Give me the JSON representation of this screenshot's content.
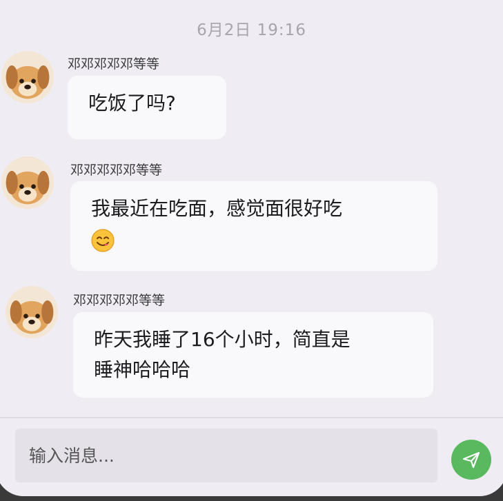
{
  "chat": {
    "timestamp": "6月2日 19:16",
    "messages": [
      {
        "sender": "邓邓邓邓邓等等",
        "lines": [
          "吃饭了吗?"
        ],
        "emoji": ""
      },
      {
        "sender": "邓邓邓邓邓等等",
        "lines": [
          "我最近在吃面，感觉面很好吃"
        ],
        "emoji": "smiling-face-savoring-food-icon"
      },
      {
        "sender": "邓邓邓邓邓等等",
        "lines": [
          "昨天我睡了16个小时，简直是",
          "睡神哈哈哈"
        ],
        "emoji": ""
      }
    ]
  },
  "composer": {
    "placeholder": "输入消息...",
    "send_icon": "send-icon"
  },
  "colors": {
    "background": "#efedf3",
    "bubble": "#f9f8fb",
    "send_button": "#59b95e"
  }
}
